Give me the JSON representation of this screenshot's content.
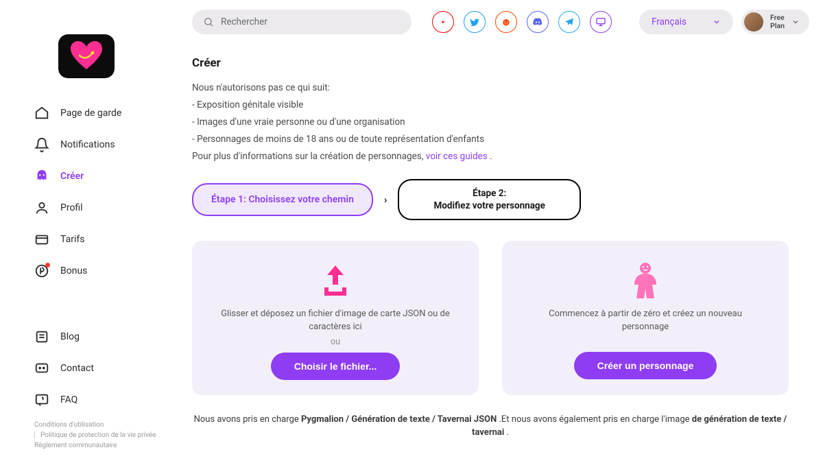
{
  "sidebar": {
    "nav": [
      {
        "label": "Page de garde",
        "id": "home"
      },
      {
        "label": "Notifications",
        "id": "notifications"
      },
      {
        "label": "Créer",
        "id": "create",
        "active": true
      },
      {
        "label": "Profil",
        "id": "profile"
      },
      {
        "label": "Tarifs",
        "id": "pricing"
      },
      {
        "label": "Bonus",
        "id": "bonus"
      }
    ],
    "secondary": [
      {
        "label": "Blog",
        "id": "blog"
      },
      {
        "label": "Contact",
        "id": "contact"
      },
      {
        "label": "FAQ",
        "id": "faq"
      }
    ],
    "footer": {
      "terms": "Conditions d'utilisation",
      "privacy": "Politique de protection de la vie privée",
      "community": "Règlement communautaire"
    }
  },
  "topbar": {
    "search_placeholder": "Rechercher",
    "language": "Français",
    "plan_line1": "Free",
    "plan_line2": "Plan"
  },
  "content": {
    "title": "Créer",
    "rules_intro": "Nous n'autorisons pas ce qui suit:",
    "rule1": "- Exposition génitale visible",
    "rule2": "- Images d'une vraie personne ou d'une organisation",
    "rule3": "- Personnages de moins de 18 ans ou de toute représentation d'enfants",
    "more_info_prefix": "Pour plus d'informations sur la création de personnages, ",
    "more_info_link": "voir ces guides",
    "step1_prefix": "Étape 1:",
    "step1_text": "Choisissez votre chemin",
    "step2_prefix": "Étape 2:",
    "step2_text": "Modifiez votre personnage",
    "upload_card": {
      "text1": "Glisser et déposez un fichier d'image de carte JSON ou de caractères ici",
      "or": "ou",
      "btn": "Choisir le fichier..."
    },
    "create_card": {
      "text1": "Commencez à partir de zéro et créez un nouveau personnage",
      "btn": "Créer un personnage"
    },
    "supported_prefix": "Nous avons pris en charge ",
    "supported_formats": "Pygmalion / Génération de texte / Tavernai JSON",
    "supported_mid": " .Et nous avons également pris en charge l'image ",
    "supported_formats2": "de génération de texte / tavernai",
    "supported_end": " ."
  },
  "colors": {
    "youtube": "#ff0000",
    "twitter": "#1da1f2",
    "reddit": "#ff4500",
    "discord": "#5865f2",
    "telegram": "#27a7e7",
    "stream": "#8e3df2"
  }
}
